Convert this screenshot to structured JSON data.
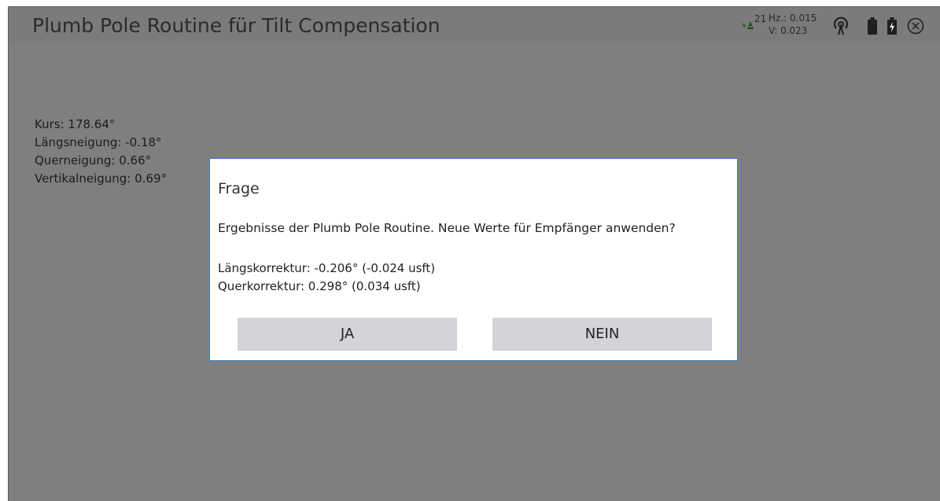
{
  "header": {
    "title": "Plumb Pole Routine für Tilt Compensation",
    "satellites": "21",
    "hz_precision": "Hz.: 0.015",
    "v_precision": "V: 0.023",
    "icons": [
      "satellite-icon",
      "radio-signal-icon",
      "battery-icon",
      "battery-charging-icon",
      "close-icon"
    ]
  },
  "readout": {
    "kurs": "Kurs: 178.64°",
    "laengsneigung": "Längsneigung: -0.18°",
    "querneigung": "Querneigung: 0.66°",
    "vertikalneigung": "Vertikalneigung: 0.69°"
  },
  "dialog": {
    "title": "Frage",
    "message": "Ergebnisse der Plumb Pole Routine. Neue Werte für Empfänger anwenden?",
    "laengskorrektur": "Längskorrektur: -0.206° (-0.024 usft)",
    "querkorrektur": "Querkorrektur: 0.298° (0.034 usft)",
    "yes_label": "JA",
    "no_label": "NEIN"
  },
  "colors": {
    "background": "#7f7f7f",
    "dialog_border": "#2f7fc8",
    "button": "#d3d3d8",
    "satellite_icon": "#3a6b2a"
  }
}
